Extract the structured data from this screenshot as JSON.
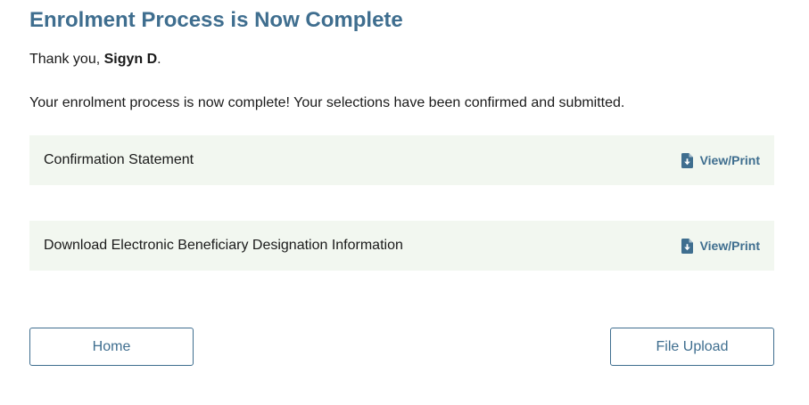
{
  "title": "Enrolment Process is Now Complete",
  "greeting": {
    "prefix": "Thank you, ",
    "name": "Sigyn D",
    "suffix": "."
  },
  "message": "Your enrolment process is now complete! Your selections have been confirmed and submitted.",
  "documents": [
    {
      "label": "Confirmation Statement",
      "action_label": "View/Print",
      "icon": "file-download-icon"
    },
    {
      "label": "Download Electronic Beneficiary Designation Information",
      "action_label": "View/Print",
      "icon": "file-download-icon"
    }
  ],
  "buttons": {
    "home": "Home",
    "file_upload": "File Upload"
  },
  "colors": {
    "accent": "#3f6e8f",
    "row_background": "#f2f7f0"
  }
}
